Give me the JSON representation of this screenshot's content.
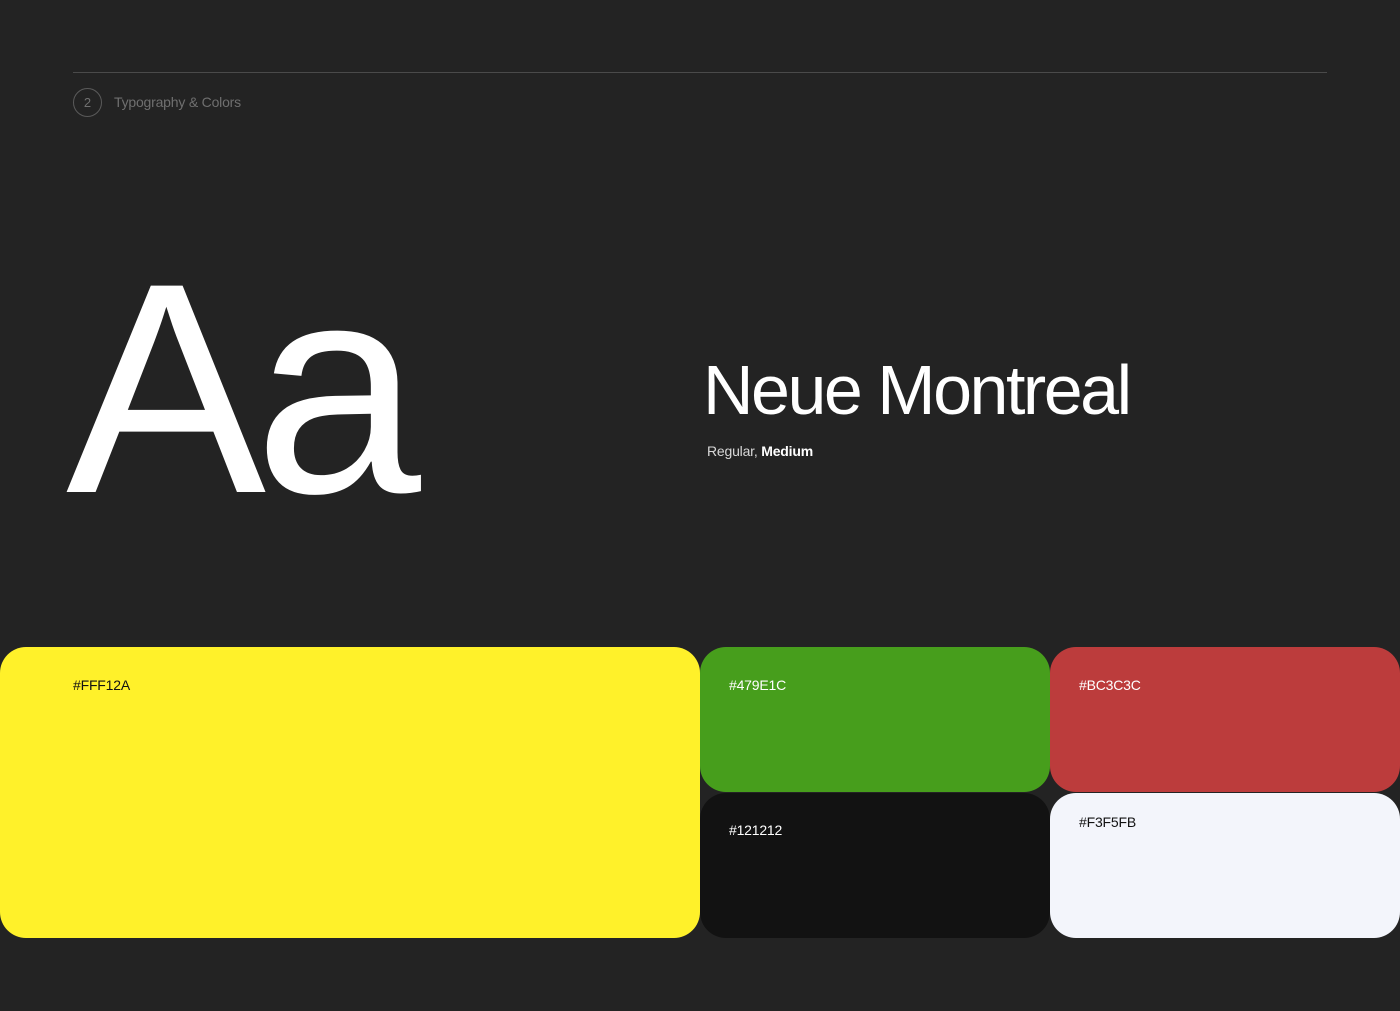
{
  "section": {
    "number": "2",
    "title": "Typography & Colors"
  },
  "typography": {
    "glyph_sample": "Aa",
    "font_name": "Neue Montreal",
    "weight_regular": "Regular,",
    "weight_medium": "Medium"
  },
  "colors": [
    {
      "hex_label": "#FFF12A",
      "fill": "#FFF12A",
      "text_color": "#121212"
    },
    {
      "hex_label": "#479E1C",
      "fill": "#479E1C",
      "text_color": "#ffffff"
    },
    {
      "hex_label": "#BC3C3C",
      "fill": "#BC3C3C",
      "text_color": "#ffffff"
    },
    {
      "hex_label": "#121212",
      "fill": "#121212",
      "text_color": "#ffffff"
    },
    {
      "hex_label": "#F3F5FB",
      "fill": "#F3F5FB",
      "text_color": "#121212"
    }
  ],
  "theme": {
    "background": "#232323",
    "foreground": "#ffffff"
  }
}
